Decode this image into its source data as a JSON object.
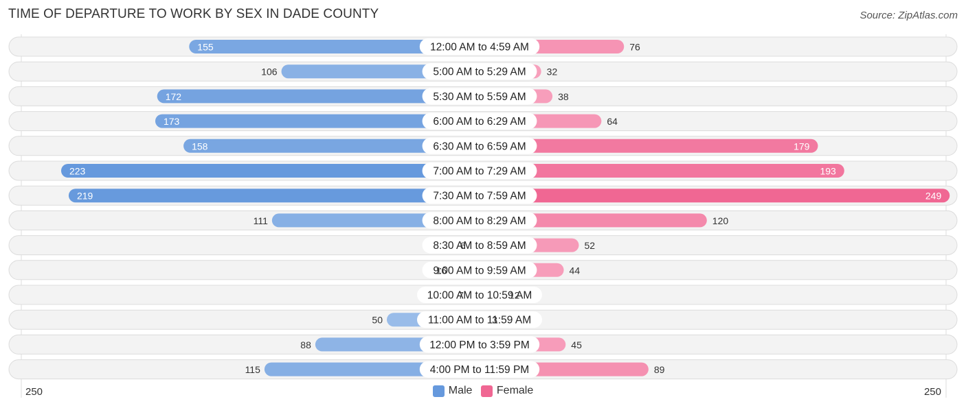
{
  "title": "TIME OF DEPARTURE TO WORK BY SEX IN DADE COUNTY",
  "source": "Source: ZipAtlas.com",
  "colors": {
    "male": "#6699dd",
    "male_light": "#a8c6ec",
    "female": "#f06793",
    "female_light": "#f8a8c2"
  },
  "legend": [
    {
      "label": "Male"
    },
    {
      "label": "Female"
    }
  ],
  "axis": {
    "left_label": "250",
    "right_label": "250"
  },
  "chart_data": {
    "type": "bar",
    "orientation": "horizontal-diverging",
    "title": "TIME OF DEPARTURE TO WORK BY SEX IN DADE COUNTY",
    "categories": [
      "12:00 AM to 4:59 AM",
      "5:00 AM to 5:29 AM",
      "5:30 AM to 5:59 AM",
      "6:00 AM to 6:29 AM",
      "6:30 AM to 6:59 AM",
      "7:00 AM to 7:29 AM",
      "7:30 AM to 7:59 AM",
      "8:00 AM to 8:29 AM",
      "8:30 AM to 8:59 AM",
      "9:00 AM to 9:59 AM",
      "10:00 AM to 10:59 AM",
      "11:00 AM to 11:59 AM",
      "12:00 PM to 3:59 PM",
      "4:00 PM to 11:59 PM"
    ],
    "series": [
      {
        "name": "Male",
        "values": [
          155,
          106,
          172,
          173,
          158,
          223,
          219,
          111,
          6,
          16,
          7,
          50,
          88,
          115
        ]
      },
      {
        "name": "Female",
        "values": [
          76,
          32,
          38,
          64,
          179,
          193,
          249,
          120,
          52,
          44,
          12,
          3,
          45,
          89
        ]
      }
    ],
    "xlim": [
      250,
      250
    ],
    "legend_position": "bottom-center"
  }
}
